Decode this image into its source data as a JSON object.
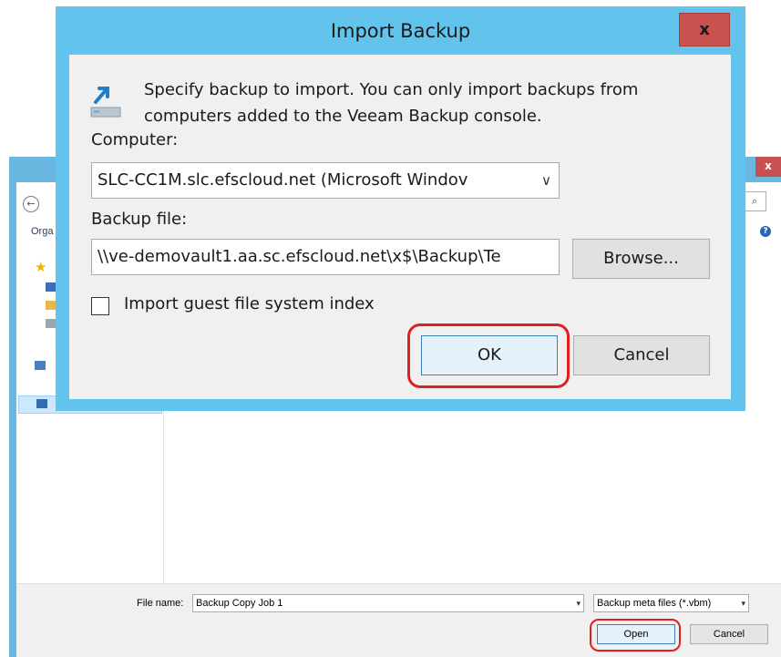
{
  "open_dialog": {
    "close_glyph": "x",
    "organize_label": "Orga",
    "search_glyph": "⌕",
    "help_glyph": "?",
    "file_name_label": "File name:",
    "file_name_value": "Backup Copy Job 1",
    "file_type_value": "Backup meta files (*.vbm)",
    "open_label": "Open",
    "cancel_label": "Cancel"
  },
  "import_dialog": {
    "title": "Import Backup",
    "close_glyph": "x",
    "description_line1": "Specify backup to import. You can only import backups from",
    "description_line2": "computers added to the Veeam Backup console.",
    "computer_label": "Computer:",
    "computer_value": "SLC-CC1M.slc.efscloud.net (Microsoft Windov",
    "backup_file_label": "Backup file:",
    "backup_file_value": "\\\\ve-demovault1.aa.sc.efscloud.net\\x$\\Backup\\Te",
    "browse_label": "Browse...",
    "import_index_label": "Import guest file system index",
    "import_index_checked": false,
    "ok_label": "OK",
    "cancel_label": "Cancel"
  },
  "colors": {
    "dialog_frame": "#62c4ec",
    "highlight": "#e02020",
    "close_button": "#c9524f"
  }
}
